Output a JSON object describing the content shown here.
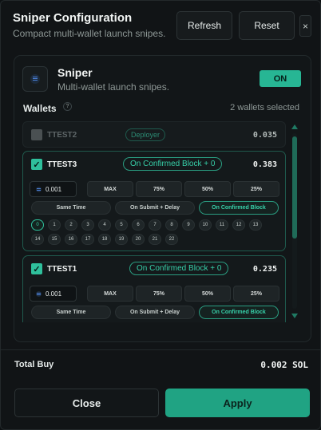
{
  "header": {
    "title": "Sniper Configuration",
    "subtitle": "Compact multi-wallet launch snipes.",
    "refresh_label": "Refresh",
    "reset_label": "Reset",
    "close_glyph": "×"
  },
  "sniper": {
    "title": "Sniper",
    "subtitle": "Multi-wallet launch snipes.",
    "status": "ON",
    "icon": "solana-icon"
  },
  "wallets": {
    "label": "Wallets",
    "info_glyph": "?",
    "count_text": "2 wallets selected",
    "disabled": {
      "name": "TTEST2",
      "tag": "Deployer",
      "value": "0.035"
    },
    "cards": [
      {
        "name": "TTEST3",
        "checked": true,
        "block_tag": "On Confirmed Block + 0",
        "value": "0.383",
        "amount": "0.001",
        "presets": [
          "MAX",
          "75%",
          "50%",
          "25%"
        ],
        "modes": [
          "Same Time",
          "On Submit + Delay",
          "On Confirmed Block"
        ],
        "active_mode": "On Confirmed Block",
        "blocks": [
          "0",
          "1",
          "2",
          "3",
          "4",
          "5",
          "6",
          "7",
          "8",
          "9",
          "10",
          "11",
          "12",
          "13",
          "14",
          "15",
          "16",
          "17",
          "18",
          "19",
          "20",
          "21",
          "22"
        ],
        "active_block": "0"
      },
      {
        "name": "TTEST1",
        "checked": true,
        "block_tag": "On Confirmed Block + 0",
        "value": "0.235",
        "amount": "0.001",
        "presets": [
          "MAX",
          "75%",
          "50%",
          "25%"
        ],
        "modes": [
          "Same Time",
          "On Submit + Delay",
          "On Confirmed Block"
        ],
        "active_mode": "On Confirmed Block"
      }
    ]
  },
  "footer": {
    "total_label": "Total Buy",
    "total_value": "0.002 SOL",
    "close_label": "Close",
    "apply_label": "Apply"
  },
  "colors": {
    "accent": "#2fc09c",
    "apply": "#20a383",
    "background": "#111416"
  }
}
